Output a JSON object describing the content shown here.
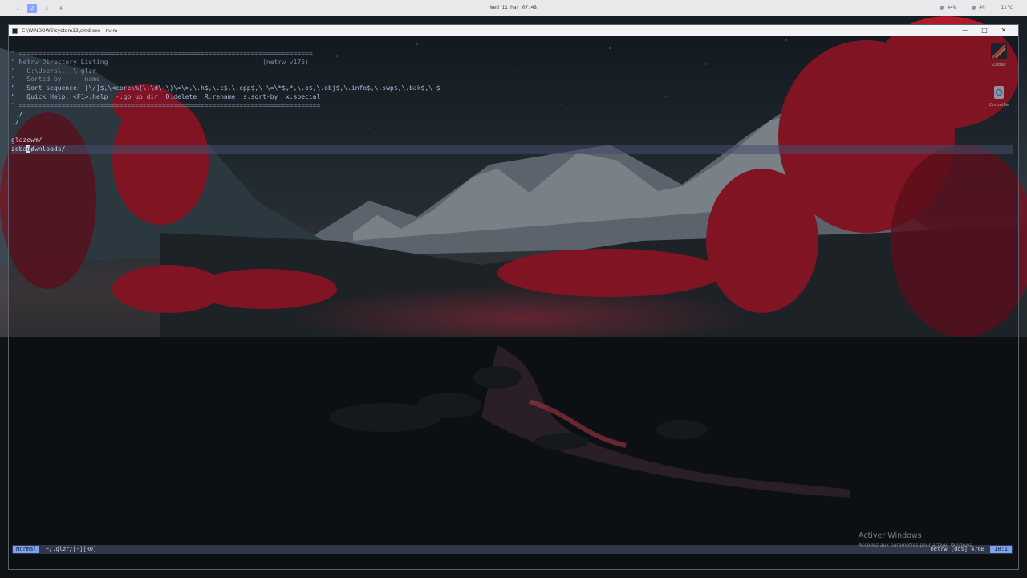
{
  "topbar": {
    "workspaces": [
      "1",
      "2",
      "3",
      "4"
    ],
    "active_workspace": "2",
    "clock": "Wed 11 Mar 07:48",
    "tray": [
      "44%",
      "4%",
      "11°C"
    ]
  },
  "window": {
    "title": "C:\\WINDOWS\\system32\\cmd.exe - nvim",
    "controls": {
      "minimize": "—",
      "maximize": "□",
      "close": "✕"
    }
  },
  "netrw": {
    "header": [
      "\" ============================================================================",
      "\" Netrw Directory Listing                                        (netrw v175)",
      "\"   C:\\Users\\...\\.glzr",
      "\"   Sorted by      name",
      "\"   Sort sequence: [\\/]$,\\<core\\%(\\.\\d\\+\\)\\=\\>,\\.h$,\\.c$,\\.cpp$,\\~\\=\\*$,*,\\.o$,\\.obj$,\\.info$,\\.swp$,\\.bak$,\\~$",
      "\"   Quick Help: <F1>:help  -:go up dir  D:delete  R:rename  s:sort-by  x:special",
      "\" =============================================================================="
    ],
    "entries": [
      "../",
      "./",
      "downloads/",
      "glazewm/",
      "zebar/"
    ],
    "selected_index": 2
  },
  "statusline": {
    "mode": "Normal",
    "file": "~/.glzr/[-][RO]",
    "filetype": "netrw [dos] 476B",
    "position": "10:1"
  },
  "watermark": {
    "title": "Activer Windows",
    "subtitle": "Accédez aux paramètres pour activer Windows."
  },
  "desktop_icons": [
    {
      "label": "Zebar",
      "icon": "zebar-icon"
    },
    {
      "label": "Corbeille",
      "icon": "recycle-bin-icon"
    }
  ],
  "colors": {
    "accent": "#7aa2f7",
    "topbar_bg": "#e9e9ec",
    "cursorline": "#464c6e"
  }
}
